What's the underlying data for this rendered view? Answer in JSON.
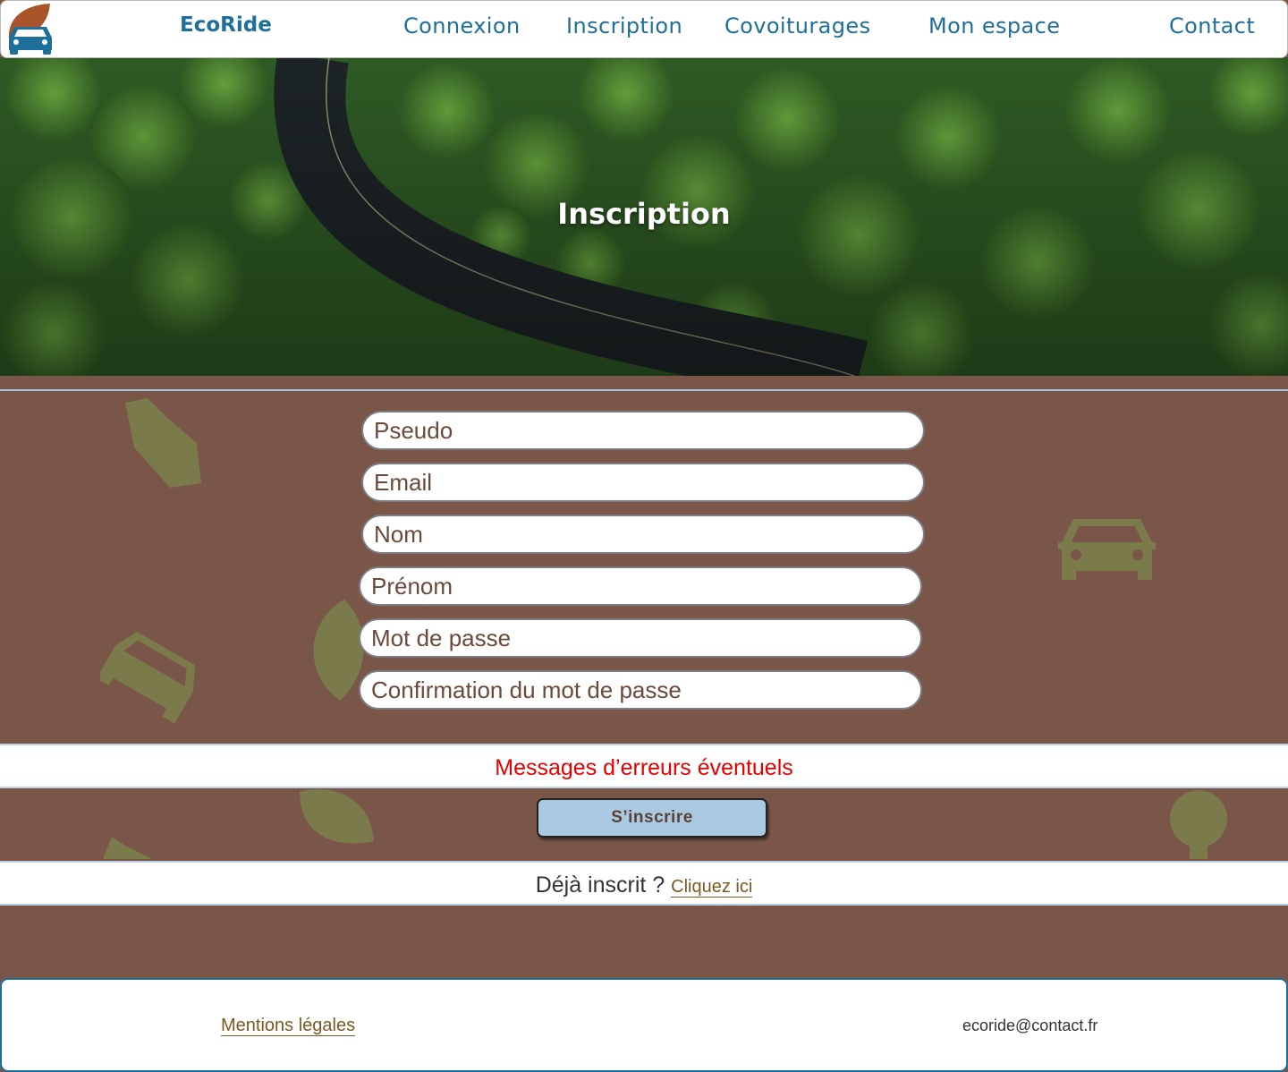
{
  "header": {
    "brand": "EcoRide",
    "nav": [
      "Connexion",
      "Inscription",
      "Covoiturages",
      "Mon espace",
      "Contact"
    ]
  },
  "hero": {
    "title": "Inscription"
  },
  "form": {
    "pseudo_placeholder": "Pseudo",
    "email_placeholder": "Email",
    "nom_placeholder": "Nom",
    "prenom_placeholder": "Prénom",
    "password_placeholder": "Mot de passe",
    "confirm_placeholder": "Confirmation du mot de passe",
    "error_message": "Messages d’erreurs éventuels",
    "submit_label": "S’inscrire",
    "already_text": "Déjà inscrit ?",
    "already_link": "Cliquez ici"
  },
  "footer": {
    "legal_link": "Mentions légales",
    "email": "ecoride@contact.fr"
  },
  "colors": {
    "brand_blue": "#1e6f99",
    "page_brown": "#7a5648",
    "icon_olive": "#7a7a4a",
    "button_blue": "#abc9e0",
    "error_red": "#e60000",
    "link_gold": "#7a5a22"
  }
}
